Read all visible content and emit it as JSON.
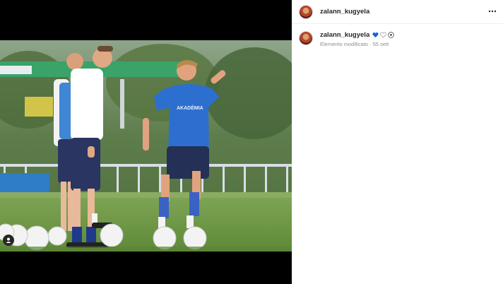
{
  "post": {
    "username": "zalann_kugyela",
    "caption_username": "zalann_kugyela",
    "caption_emojis": [
      "blue-heart-icon",
      "white-heart-icon",
      "soccer-ball-icon"
    ],
    "edited_label": "Elemento modificato",
    "separator": "·",
    "time_ago": "55 sett",
    "shirt_text": "AKADÉMIA"
  },
  "colors": {
    "shirt_blue": "#2d6fcf",
    "shorts_navy": "#2a3561",
    "grass": "#6f9b43"
  }
}
